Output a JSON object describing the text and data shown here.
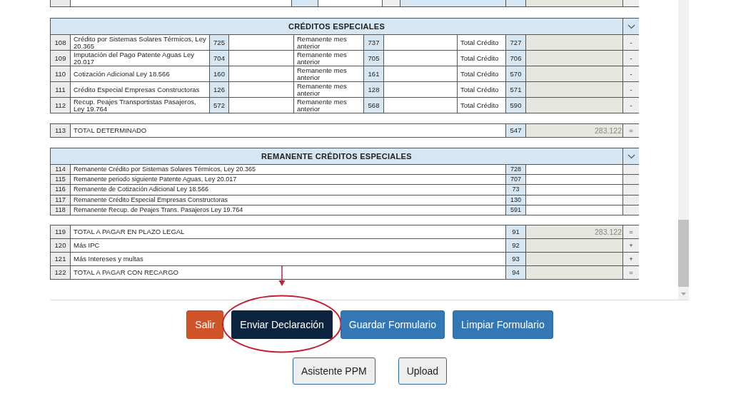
{
  "creditos": {
    "title": "CRÉDITOS ESPECIALES",
    "rows": [
      {
        "number": "108",
        "label": "Crédito por Sistemas Solares Térmicos, Ley 20.365",
        "code": "725",
        "remanente_label": "Remanente mes anterior",
        "remanente_code": "737",
        "total_label": "Total Crédito",
        "total_code": "727",
        "sign": "-"
      },
      {
        "number": "109",
        "label": "Imputación del Pago Patente Aguas Ley 20.017",
        "code": "704",
        "remanente_label": "Remanente mes anterior",
        "remanente_code": "705",
        "total_label": "Total Crédito",
        "total_code": "706",
        "sign": "-"
      },
      {
        "number": "110",
        "label": "Cotización Adicional Ley 18.566",
        "code": "160",
        "remanente_label": "Remanente mes anterior",
        "remanente_code": "161",
        "total_label": "Total Crédito",
        "total_code": "570",
        "sign": "-"
      },
      {
        "number": "111",
        "label": "Crédito Especial Empresas Constructoras",
        "code": "126",
        "remanente_label": "Remanente mes anterior",
        "remanente_code": "128",
        "total_label": "Total Crédito",
        "total_code": "571",
        "sign": "-"
      },
      {
        "number": "112",
        "label": "Recup. Peajes Transportistas Pasajeros, Ley 19.764",
        "code": "572",
        "remanente_label": "Remanente mes anterior",
        "remanente_code": "568",
        "total_label": "Total Crédito",
        "total_code": "590",
        "sign": "-"
      }
    ]
  },
  "total_determinado": {
    "number": "113",
    "label": "TOTAL DETERMINADO",
    "code": "547",
    "value": "283.122",
    "sign": "="
  },
  "remanente": {
    "title": "REMANENTE CRÉDITOS ESPECIALES",
    "rows": [
      {
        "number": "114",
        "label": "Remanente Crédito por Sistemas Solares Térmicos, Ley 20.365",
        "code": "728"
      },
      {
        "number": "115",
        "label": "Remanente periodo siguiente Patente Aguas, Ley 20.017",
        "code": "707"
      },
      {
        "number": "116",
        "label": "Remanente de Cotización Adicional Ley 18.566",
        "code": "73"
      },
      {
        "number": "117",
        "label": "Remanente Crédito Especial Empresas Constructoras",
        "code": "130"
      },
      {
        "number": "118",
        "label": "Remanente Recup. de Peajes Trans. Pasajeros Ley 19.764",
        "code": "591"
      }
    ]
  },
  "totales": [
    {
      "number": "119",
      "label": "TOTAL A PAGAR EN PLAZO LEGAL",
      "code": "91",
      "value": "283.122",
      "sign": "="
    },
    {
      "number": "120",
      "label": "Más IPC",
      "code": "92",
      "sign": "+"
    },
    {
      "number": "121",
      "label": "Más Intereses y multas",
      "code": "93",
      "sign": "+"
    },
    {
      "number": "122",
      "label": "TOTAL A PAGAR CON RECARGO",
      "code": "94",
      "sign": "="
    }
  ],
  "buttons": [
    [
      {
        "label": "Salir",
        "kind": "danger",
        "highlighted": false
      },
      {
        "label": "Enviar Declaración",
        "kind": "dark",
        "highlighted": true
      },
      {
        "label": "Guardar Formulario",
        "kind": "primary",
        "highlighted": false
      },
      {
        "label": "Limpiar Formulario",
        "kind": "primary",
        "highlighted": false
      }
    ],
    [
      {
        "label": "Asistente PPM",
        "kind": "light",
        "highlighted": false
      },
      {
        "label": "Upload",
        "kind": "light",
        "highlighted": false
      }
    ]
  ]
}
